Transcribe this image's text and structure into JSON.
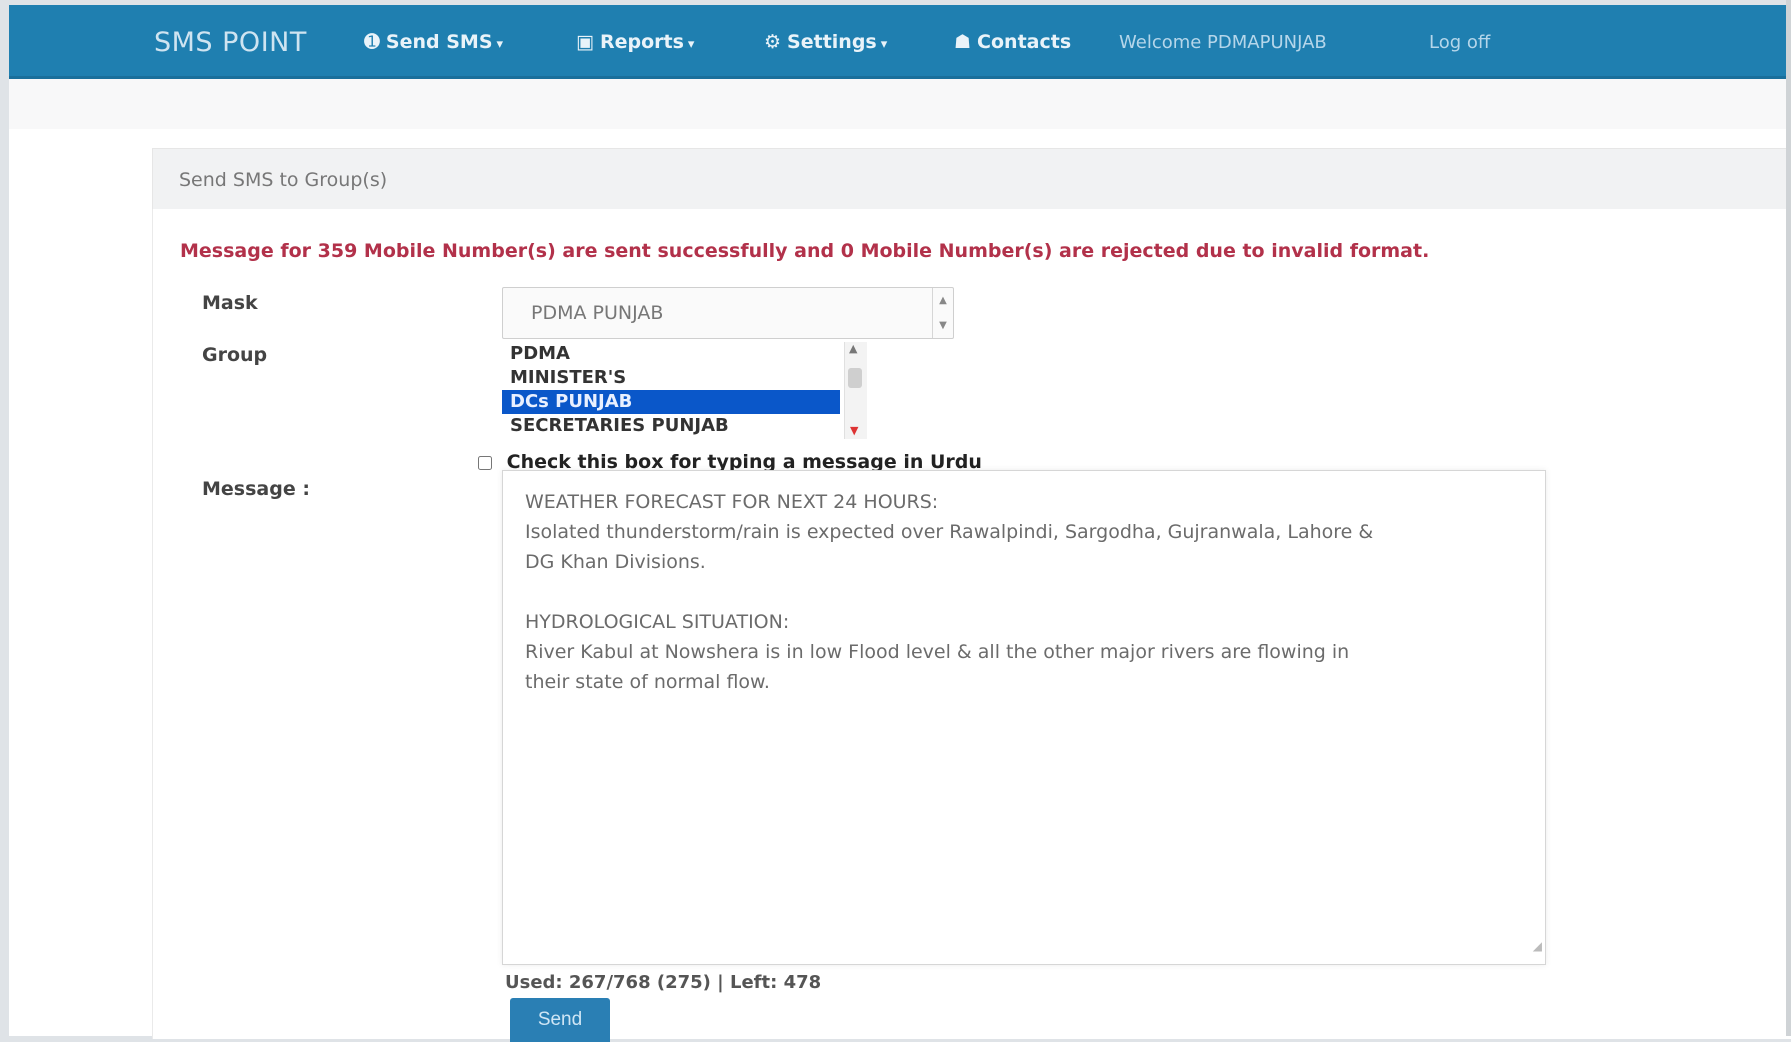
{
  "nav": {
    "brand": "SMS POINT",
    "items": [
      {
        "icon": "send-icon",
        "glyph": "➊",
        "label": "Send SMS"
      },
      {
        "icon": "reports-icon",
        "glyph": "▣",
        "label": "Reports"
      },
      {
        "icon": "settings-icon",
        "glyph": "⚙",
        "label": "Settings"
      },
      {
        "icon": "contacts-icon",
        "glyph": "☗",
        "label": "Contacts"
      }
    ],
    "welcome": "Welcome PDMAPUNJAB",
    "logout": "Log off"
  },
  "panel": {
    "title": "Send SMS to Group(s)"
  },
  "alert": "Message for 359 Mobile Number(s) are sent successfully and 0 Mobile Number(s) are rejected due to invalid format.",
  "form": {
    "mask_label": "Mask",
    "mask_value": "PDMA PUNJAB",
    "group_label": "Group",
    "group_options": [
      "PDMA",
      "MINISTER'S",
      "DCs PUNJAB",
      "SECRETARIES PUNJAB"
    ],
    "group_selected": "DCs PUNJAB",
    "urdu_checkbox_label": "Check this box for typing a message in Urdu",
    "urdu_checked": false,
    "message_label": "Message :",
    "message_lines": {
      "l1": "WEATHER FORECAST FOR NEXT 24 HOURS:",
      "l2": "Isolated thunderstorm/rain is expected over Rawalpindi, Sargodha, Gujranwala, Lahore &",
      "l3": "DG Khan Divisions.",
      "l4": "HYDROLOGICAL SITUATION:",
      "l5": "River Kabul at Nowshera is in low Flood level & all the other major rivers are flowing in",
      "l6": "their state of normal flow."
    },
    "counter": "Used: 267/768 (275) | Left: 478",
    "send_label": "Send"
  }
}
